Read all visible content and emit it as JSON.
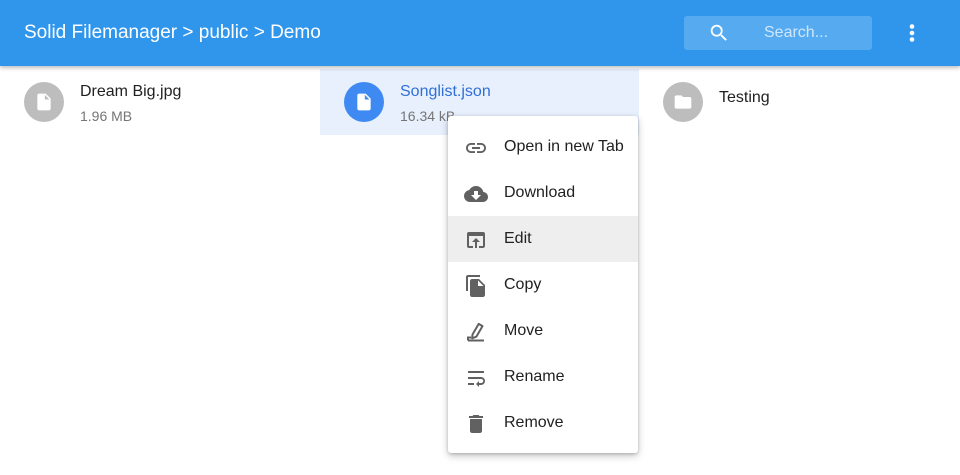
{
  "app": {
    "breadcrumb": "Solid Filemanager > public > Demo"
  },
  "search": {
    "placeholder": "Search..."
  },
  "colors": {
    "appbar": "#2f96ec",
    "selected_bg": "#e8f0fd",
    "selected_accent": "#3f8af2"
  },
  "files": [
    {
      "name": "Dream Big.jpg",
      "size": "1.96 MB",
      "icon": "file-icon",
      "selected": false
    },
    {
      "name": "Songlist.json",
      "size": "16.34 kB",
      "icon": "file-icon",
      "selected": true
    },
    {
      "name": "Testing",
      "size": "",
      "icon": "folder-icon",
      "selected": false
    }
  ],
  "context_menu": {
    "items": [
      {
        "label": "Open in new Tab",
        "icon": "link-icon"
      },
      {
        "label": "Download",
        "icon": "cloud-download-icon"
      },
      {
        "label": "Edit",
        "icon": "open-in-browser-icon"
      },
      {
        "label": "Copy",
        "icon": "copy-icon"
      },
      {
        "label": "Move",
        "icon": "move-icon"
      },
      {
        "label": "Rename",
        "icon": "wrap-text-icon"
      },
      {
        "label": "Remove",
        "icon": "trash-icon"
      }
    ],
    "highlighted": "Edit"
  }
}
